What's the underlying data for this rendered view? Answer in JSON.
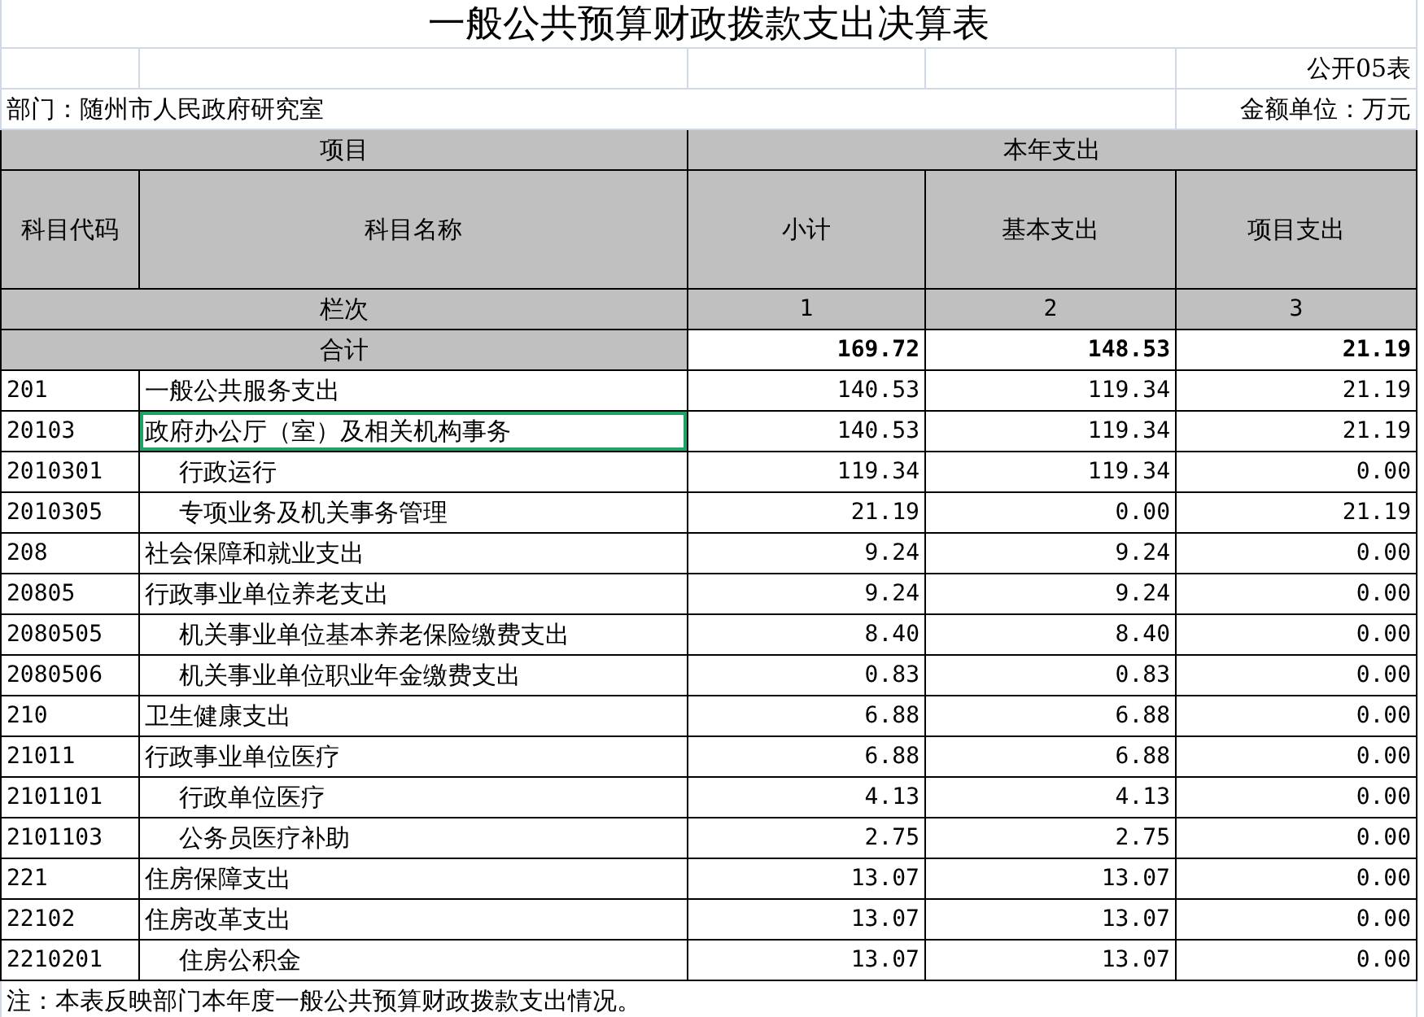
{
  "title": "一般公共预算财政拨款支出决算表",
  "form_no": "公开05表",
  "department": "部门：随州市人民政府研究室",
  "unit": "金额单位：万元",
  "header": {
    "group_left": "项目",
    "group_right": "本年支出",
    "columns": [
      "科目代码",
      "科目名称",
      "小计",
      "基本支出",
      "项目支出"
    ],
    "index_label": "栏次",
    "indices": [
      "1",
      "2",
      "3"
    ],
    "total_label": "合计",
    "totals": [
      "169.72",
      "148.53",
      "21.19"
    ]
  },
  "rows": [
    {
      "code": "201",
      "name": "一般公共服务支出",
      "values": [
        "140.53",
        "119.34",
        "21.19"
      ],
      "selected": false,
      "children": [
        {
          "code": "20103",
          "name": "政府办公厅（室）及相关机构事务",
          "values": [
            "140.53",
            "119.34",
            "21.19"
          ],
          "selected": true,
          "children": [
            {
              "code": "2010301",
              "name": "行政运行",
              "values": [
                "119.34",
                "119.34",
                "0.00"
              ],
              "selected": false
            },
            {
              "code": "2010305",
              "name": "专项业务及机关事务管理",
              "values": [
                "21.19",
                "0.00",
                "21.19"
              ],
              "selected": false
            }
          ]
        }
      ]
    },
    {
      "code": "208",
      "name": "社会保障和就业支出",
      "values": [
        "9.24",
        "9.24",
        "0.00"
      ],
      "selected": false,
      "children": [
        {
          "code": "20805",
          "name": "行政事业单位养老支出",
          "values": [
            "9.24",
            "9.24",
            "0.00"
          ],
          "selected": false,
          "children": [
            {
              "code": "2080505",
              "name": "机关事业单位基本养老保险缴费支出",
              "values": [
                "8.40",
                "8.40",
                "0.00"
              ],
              "selected": false
            },
            {
              "code": "2080506",
              "name": "机关事业单位职业年金缴费支出",
              "values": [
                "0.83",
                "0.83",
                "0.00"
              ],
              "selected": false
            }
          ]
        }
      ]
    },
    {
      "code": "210",
      "name": "卫生健康支出",
      "values": [
        "6.88",
        "6.88",
        "0.00"
      ],
      "selected": false,
      "children": [
        {
          "code": "21011",
          "name": "行政事业单位医疗",
          "values": [
            "6.88",
            "6.88",
            "0.00"
          ],
          "selected": false,
          "children": [
            {
              "code": "2101101",
              "name": "行政单位医疗",
              "values": [
                "4.13",
                "4.13",
                "0.00"
              ],
              "selected": false
            },
            {
              "code": "2101103",
              "name": "公务员医疗补助",
              "values": [
                "2.75",
                "2.75",
                "0.00"
              ],
              "selected": false
            }
          ]
        }
      ]
    },
    {
      "code": "221",
      "name": "住房保障支出",
      "values": [
        "13.07",
        "13.07",
        "0.00"
      ],
      "selected": false,
      "children": [
        {
          "code": "22102",
          "name": "住房改革支出",
          "values": [
            "13.07",
            "13.07",
            "0.00"
          ],
          "selected": false,
          "children": [
            {
              "code": "2210201",
              "name": "住房公积金",
              "values": [
                "13.07",
                "13.07",
                "0.00"
              ],
              "selected": false
            }
          ]
        }
      ]
    }
  ],
  "note": "注：本表反映部门本年度一般公共预算财政拨款支出情况。"
}
